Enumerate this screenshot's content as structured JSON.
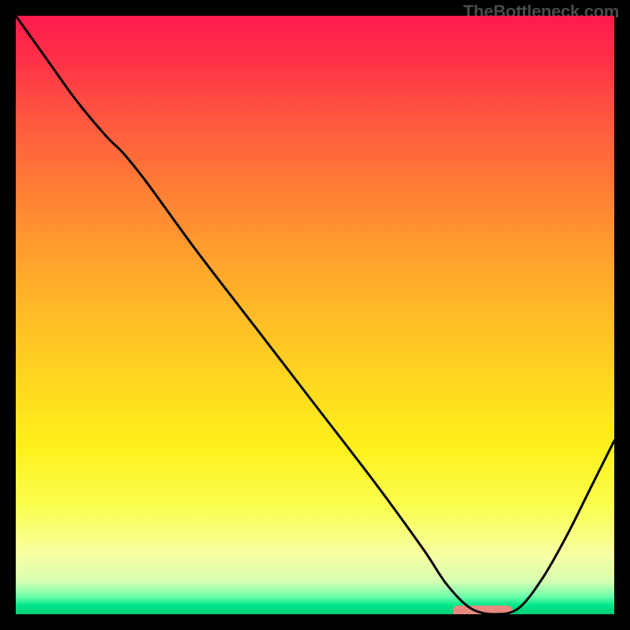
{
  "watermark": "TheBottleneck.com",
  "colors": {
    "background": "#000000",
    "curve": "#000000",
    "marker": "#e8897f",
    "gradient_top": "#ff1a4c",
    "gradient_bottom": "#00cc78"
  },
  "chart_data": {
    "type": "line",
    "title": "",
    "xlabel": "",
    "ylabel": "",
    "xlim": [
      0,
      1
    ],
    "ylim": [
      0,
      1
    ],
    "x": [
      0.0,
      0.05,
      0.1,
      0.15,
      0.18,
      0.22,
      0.3,
      0.4,
      0.5,
      0.6,
      0.68,
      0.72,
      0.76,
      0.8,
      0.84,
      0.88,
      0.92,
      0.96,
      1.0
    ],
    "values": [
      1.0,
      0.93,
      0.86,
      0.8,
      0.77,
      0.72,
      0.61,
      0.48,
      0.35,
      0.22,
      0.11,
      0.05,
      0.01,
      0.0,
      0.01,
      0.06,
      0.13,
      0.21,
      0.29
    ],
    "marker_range_x": [
      0.73,
      0.83
    ],
    "marker_y": 0.005
  }
}
